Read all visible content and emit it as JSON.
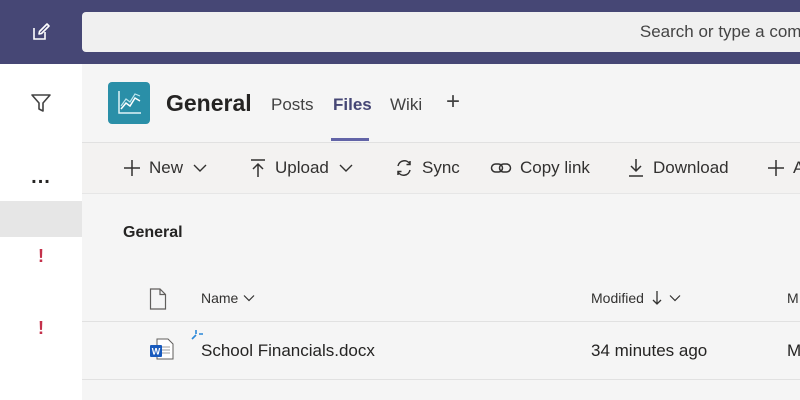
{
  "topbar": {
    "search_placeholder": "Search or type a command"
  },
  "rail": {
    "more_label": "...",
    "alert1": "!",
    "alert2": "!"
  },
  "channel": {
    "title": "General",
    "tabs": [
      {
        "label": "Posts"
      },
      {
        "label": "Files"
      },
      {
        "label": "Wiki"
      }
    ],
    "add_tab": "+"
  },
  "toolbar": {
    "new_label": "New",
    "upload_label": "Upload",
    "sync_label": "Sync",
    "copy_link_label": "Copy link",
    "download_label": "Download",
    "add_label": "A"
  },
  "files": {
    "breadcrumb": "General",
    "columns": {
      "name": "Name",
      "modified": "Modified",
      "modified_by": "M"
    },
    "rows": [
      {
        "name": "School Financials.docx",
        "modified": "34 minutes ago",
        "modified_by": "M"
      }
    ]
  },
  "colors": {
    "topbar": "#464775",
    "accent": "#6264a7",
    "alert": "#c4314b",
    "team_avatar": "#2a8fa8",
    "word_blue": "#185abd"
  }
}
